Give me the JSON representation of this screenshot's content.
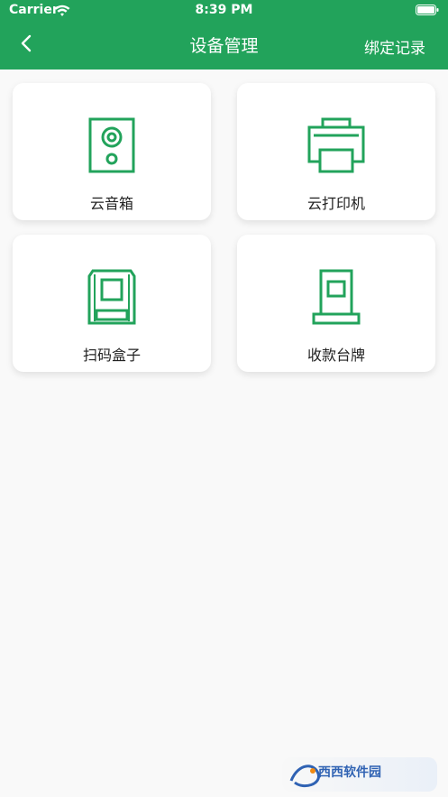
{
  "status": {
    "carrier": "Carrier",
    "time": "8:39 PM"
  },
  "header": {
    "title": "设备管理",
    "right_action": "绑定记录"
  },
  "devices": [
    {
      "label": "云音箱",
      "icon": "speaker-icon"
    },
    {
      "label": "云打印机",
      "icon": "printer-icon"
    },
    {
      "label": "扫码盒子",
      "icon": "scan-box-icon"
    },
    {
      "label": "收款台牌",
      "icon": "payment-stand-icon"
    }
  ],
  "watermark": {
    "text": "西西软件园"
  },
  "colors": {
    "primary": "#22a35b",
    "background": "#f9f9f9"
  }
}
